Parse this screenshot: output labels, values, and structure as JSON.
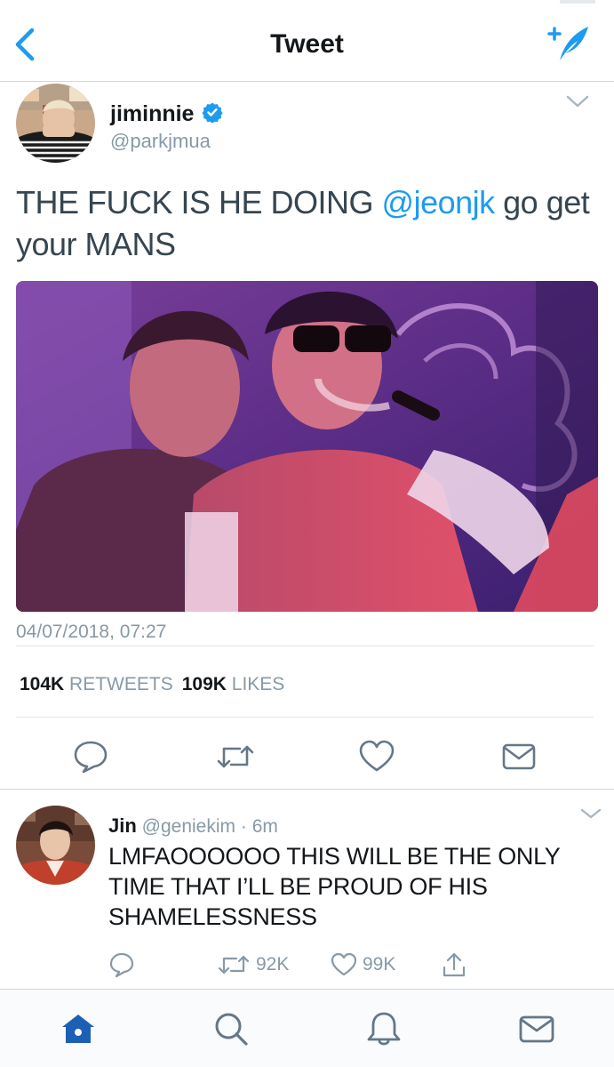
{
  "header": {
    "title": "Tweet",
    "back_icon": "chevron-left-icon",
    "compose_icon": "compose-tweet-icon"
  },
  "tweet": {
    "author_name": "jiminnie",
    "author_handle": "@parkjmua",
    "verified": true,
    "text_before": "THE FUCK IS HE DOING ",
    "mention": "@jeonjk",
    "text_after": " go get your MANS",
    "timestamp": "04/07/2018, 07:27",
    "retweets_count": "104K",
    "retweets_label": "RETWEETS",
    "likes_count": "109K",
    "likes_label": "LIKES",
    "actions": [
      "reply-icon",
      "retweet-icon",
      "like-icon",
      "direct-message-icon"
    ]
  },
  "reply": {
    "author_name": "Jin",
    "author_handle": "@geniekim",
    "separator": "·",
    "time": "6m",
    "text": "LMFAOOOOOO THIS WILL BE THE ONLY TIME THAT I’LL BE PROUD OF HIS SHAMELESSNESS",
    "retweets": "92K",
    "likes": "99K"
  },
  "tabbar": {
    "items": [
      "home-icon",
      "search-icon",
      "notifications-icon",
      "messages-icon"
    ]
  },
  "colors": {
    "accent": "#1d9bf0",
    "muted": "#8899a6",
    "text": "#14171a"
  }
}
